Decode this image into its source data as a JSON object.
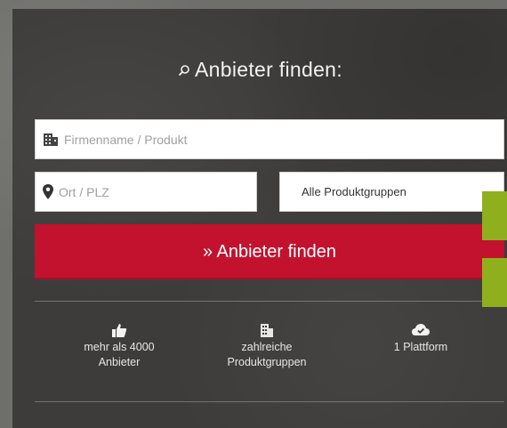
{
  "title": "Anbieter finden:",
  "search_form": {
    "company_placeholder": "Firmenname / Produkt",
    "city_placeholder": "Ort / PLZ",
    "product_group_selected": "Alle Produktgruppen",
    "submit_label": "» Anbieter finden"
  },
  "features": [
    {
      "icon": "thumbs-up-icon",
      "line1": "mehr als 4000",
      "line2": "Anbieter"
    },
    {
      "icon": "building-icon",
      "line1": "zahlreiche",
      "line2": "Produktgruppen"
    },
    {
      "icon": "cloud-check-icon",
      "line1": "1 Plattform",
      "line2": ""
    }
  ],
  "colors": {
    "submit": "#c2122e",
    "accent_tab": "#8fb01c",
    "panel": "#3d3c3a"
  }
}
